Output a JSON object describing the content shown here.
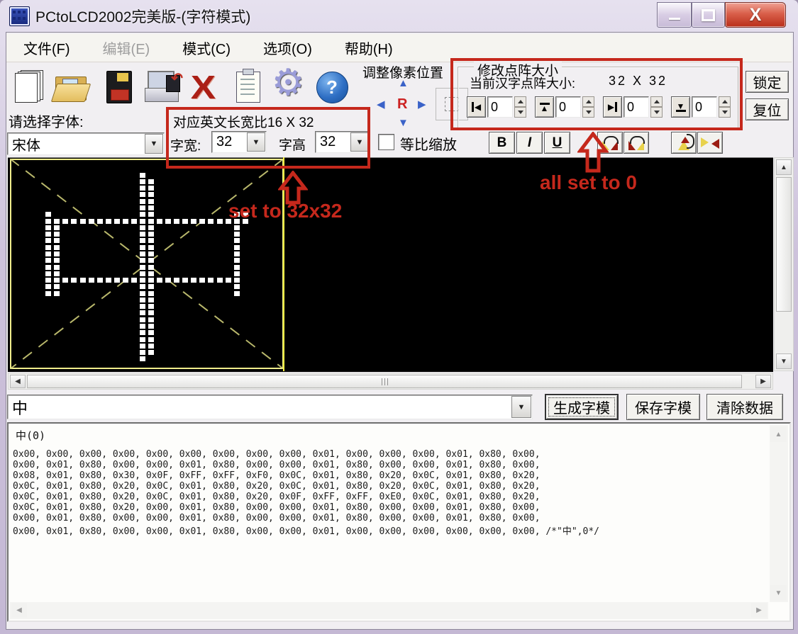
{
  "window": {
    "title": "PCtoLCD2002完美版-(字符模式)"
  },
  "menu": {
    "items": [
      {
        "label": "文件(F)"
      },
      {
        "label": "编辑(E)",
        "disabled": true
      },
      {
        "label": "模式(C)"
      },
      {
        "label": "选项(O)"
      },
      {
        "label": "帮助(H)"
      }
    ]
  },
  "toolbar": {
    "icons": [
      "new-file",
      "open-file",
      "save",
      "export",
      "delete",
      "clipboard",
      "settings",
      "help"
    ]
  },
  "font_select": {
    "label": "请选择字体:",
    "value": "宋体"
  },
  "char_size": {
    "ratio_label": "对应英文长宽比16 X 32",
    "width_label": "字宽:",
    "width_value": "32",
    "height_label": "字高",
    "height_value": "32"
  },
  "pixel_position": {
    "title": "调整像素位置",
    "center_key": "R"
  },
  "dot_matrix": {
    "title": "修改点阵大小",
    "current_label": "当前汉字点阵大小:",
    "current_value": "32 X 32",
    "spinners": [
      {
        "value": "0"
      },
      {
        "value": "0"
      },
      {
        "value": "0"
      },
      {
        "value": "0"
      }
    ]
  },
  "side_buttons": {
    "lock": "锁定",
    "reset": "复位"
  },
  "scale_checkbox": {
    "label": "等比缩放",
    "checked": false
  },
  "format": {
    "bold": "B",
    "italic": "I",
    "underline": "U"
  },
  "char_input": {
    "value": "中"
  },
  "actions": {
    "generate": "生成字模",
    "save": "保存字模",
    "clear": "清除数据"
  },
  "output": {
    "header": "中(0)",
    "lines": [
      "0x00, 0x00, 0x00, 0x00, 0x00, 0x00, 0x00, 0x00, 0x00, 0x01, 0x00, 0x00, 0x00, 0x01, 0x80, 0x00,",
      "0x00, 0x01, 0x80, 0x00, 0x00, 0x01, 0x80, 0x00, 0x00, 0x01, 0x80, 0x00, 0x00, 0x01, 0x80, 0x00,",
      "0x08, 0x01, 0x80, 0x30, 0x0F, 0xFF, 0xFF, 0xF0, 0x0C, 0x01, 0x80, 0x20, 0x0C, 0x01, 0x80, 0x20,",
      "0x0C, 0x01, 0x80, 0x20, 0x0C, 0x01, 0x80, 0x20, 0x0C, 0x01, 0x80, 0x20, 0x0C, 0x01, 0x80, 0x20,",
      "0x0C, 0x01, 0x80, 0x20, 0x0C, 0x01, 0x80, 0x20, 0x0F, 0xFF, 0xFF, 0xE0, 0x0C, 0x01, 0x80, 0x20,",
      "0x0C, 0x01, 0x80, 0x20, 0x00, 0x01, 0x80, 0x00, 0x00, 0x01, 0x80, 0x00, 0x00, 0x01, 0x80, 0x00,",
      "0x00, 0x01, 0x80, 0x00, 0x00, 0x01, 0x80, 0x00, 0x00, 0x01, 0x80, 0x00, 0x00, 0x01, 0x80, 0x00,",
      "0x00, 0x01, 0x80, 0x00, 0x00, 0x01, 0x80, 0x00, 0x00, 0x01, 0x00, 0x00, 0x00, 0x00, 0x00, 0x00, /*\"中\",0*/"
    ]
  },
  "annotations": {
    "size_note": "set to 32x32",
    "zero_note": "all set to 0",
    "accent": "#c5281c"
  },
  "colors": {
    "preview_bg": "#000000",
    "guide_yellow": "#f0ee8c",
    "pixel": "#ffffff",
    "annotation_red": "#c5281c"
  }
}
